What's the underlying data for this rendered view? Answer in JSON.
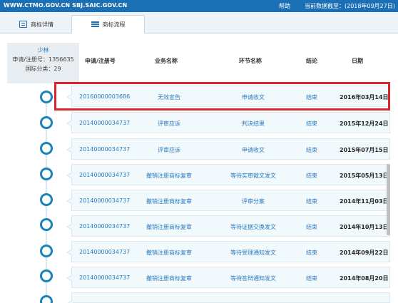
{
  "topbar": {
    "site": "WWW.CTMO.GOV.CN  SBJ.SAIC.GOV.CN",
    "help": "帮助",
    "status": "当前数据截至：(2018年09月27日)"
  },
  "tabs": [
    {
      "label": "商标详情",
      "icon": "document-icon"
    },
    {
      "label": "商标流程",
      "icon": "list-icon"
    }
  ],
  "info": {
    "name": "少林",
    "reg_no": "申请/注册号：1356635",
    "intl_class": "国际分类：29"
  },
  "table": {
    "headers": [
      "申请/注册号",
      "业务名称",
      "环节名称",
      "结论",
      "日期"
    ],
    "rows": [
      {
        "no": "20160000003686",
        "business": "无效宣告",
        "step": "申请收文",
        "result": "结束",
        "date": "2016年03月14日"
      },
      {
        "no": "20140000034737",
        "business": "评审应诉",
        "step": "判决结果",
        "result": "结束",
        "date": "2015年12月24日"
      },
      {
        "no": "20140000034737",
        "business": "评审应诉",
        "step": "申请收文",
        "result": "结束",
        "date": "2015年07月15日"
      },
      {
        "no": "20140000034737",
        "business": "撤销注册商标复审",
        "step": "等待实审裁文发文",
        "result": "结束",
        "date": "2015年05月13日"
      },
      {
        "no": "20140000034737",
        "business": "撤销注册商标复审",
        "step": "评审分案",
        "result": "结束",
        "date": "2014年11月03日"
      },
      {
        "no": "20140000034737",
        "business": "撤销注册商标复审",
        "step": "等待证据交换发文",
        "result": "结束",
        "date": "2014年10月13日"
      },
      {
        "no": "20140000034737",
        "business": "撤销注册商标复审",
        "step": "等待受理通知发文",
        "result": "结束",
        "date": "2014年09月22日"
      },
      {
        "no": "20140000034737",
        "business": "撤销注册商标复审",
        "step": "等待答辩通知发文",
        "result": "结束",
        "date": "2014年08月20日"
      }
    ]
  }
}
